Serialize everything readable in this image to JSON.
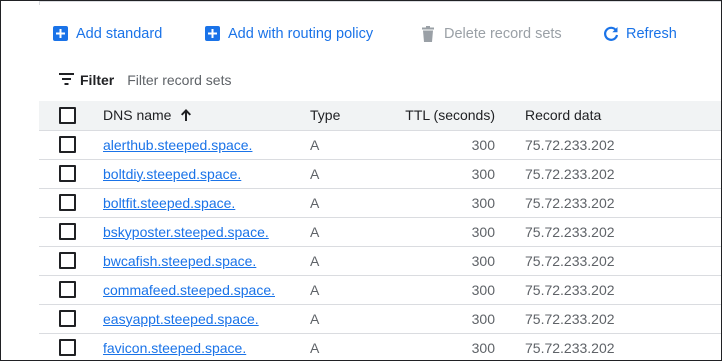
{
  "toolbar": {
    "add_standard": "Add standard",
    "add_routing": "Add with routing policy",
    "delete": "Delete record sets",
    "refresh": "Refresh"
  },
  "filter": {
    "label": "Filter",
    "placeholder": "Filter record sets"
  },
  "table": {
    "headers": {
      "name": "DNS name",
      "type": "Type",
      "ttl": "TTL (seconds)",
      "data": "Record data"
    },
    "rows": [
      {
        "name": "alerthub.steeped.space.",
        "type": "A",
        "ttl": "300",
        "data": "75.72.233.202"
      },
      {
        "name": "boltdiy.steeped.space.",
        "type": "A",
        "ttl": "300",
        "data": "75.72.233.202"
      },
      {
        "name": "boltfit.steeped.space.",
        "type": "A",
        "ttl": "300",
        "data": "75.72.233.202"
      },
      {
        "name": "bskyposter.steeped.space.",
        "type": "A",
        "ttl": "300",
        "data": "75.72.233.202"
      },
      {
        "name": "bwcafish.steeped.space.",
        "type": "A",
        "ttl": "300",
        "data": "75.72.233.202"
      },
      {
        "name": "commafeed.steeped.space.",
        "type": "A",
        "ttl": "300",
        "data": "75.72.233.202"
      },
      {
        "name": "easyappt.steeped.space.",
        "type": "A",
        "ttl": "300",
        "data": "75.72.233.202"
      },
      {
        "name": "favicon.steeped.space.",
        "type": "A",
        "ttl": "300",
        "data": "75.72.233.202"
      }
    ]
  },
  "icons": {
    "add_standard": "add-box-icon",
    "add_routing": "add-box-icon",
    "delete": "trash-icon",
    "refresh": "refresh-icon",
    "filter": "filter-icon",
    "sort": "arrow-up-icon"
  },
  "colors": {
    "accent": "#1a73e8",
    "disabled": "#9aa0a6",
    "header_bg": "#f1f3f4",
    "divider": "#dadce0"
  }
}
